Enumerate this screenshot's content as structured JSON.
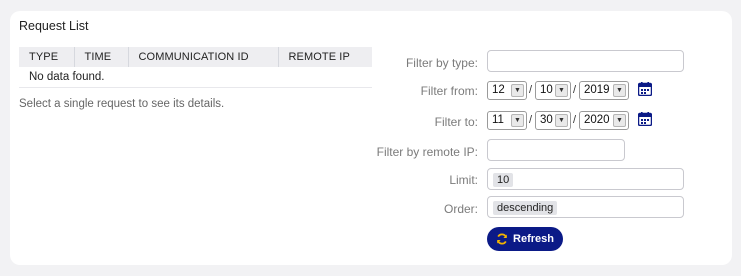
{
  "panel": {
    "title": "Request List"
  },
  "table": {
    "columns": [
      "TYPE",
      "TIME",
      "COMMUNICATION ID",
      "REMOTE IP"
    ],
    "empty_message": "No data found."
  },
  "hint": "Select a single request to see its details.",
  "filters": {
    "type_label": "Filter by type:",
    "type_value": "",
    "from_label": "Filter from:",
    "from_month": "12",
    "from_day": "10",
    "from_year": "2019",
    "to_label": "Filter to:",
    "to_month": "11",
    "to_day": "30",
    "to_year": "2020",
    "remote_ip_label": "Filter by remote IP:",
    "remote_ip_value": "",
    "limit_label": "Limit:",
    "limit_value": "10",
    "order_label": "Order:",
    "order_value": "descending"
  },
  "actions": {
    "refresh_label": "Refresh"
  },
  "icons": {
    "calendar": "calendar-icon",
    "refresh": "refresh-icon",
    "dropdown": "chevron-down-icon"
  },
  "colors": {
    "primary_button": "#0b1a87",
    "background": "#f2f2f4",
    "panel": "#ffffff"
  }
}
